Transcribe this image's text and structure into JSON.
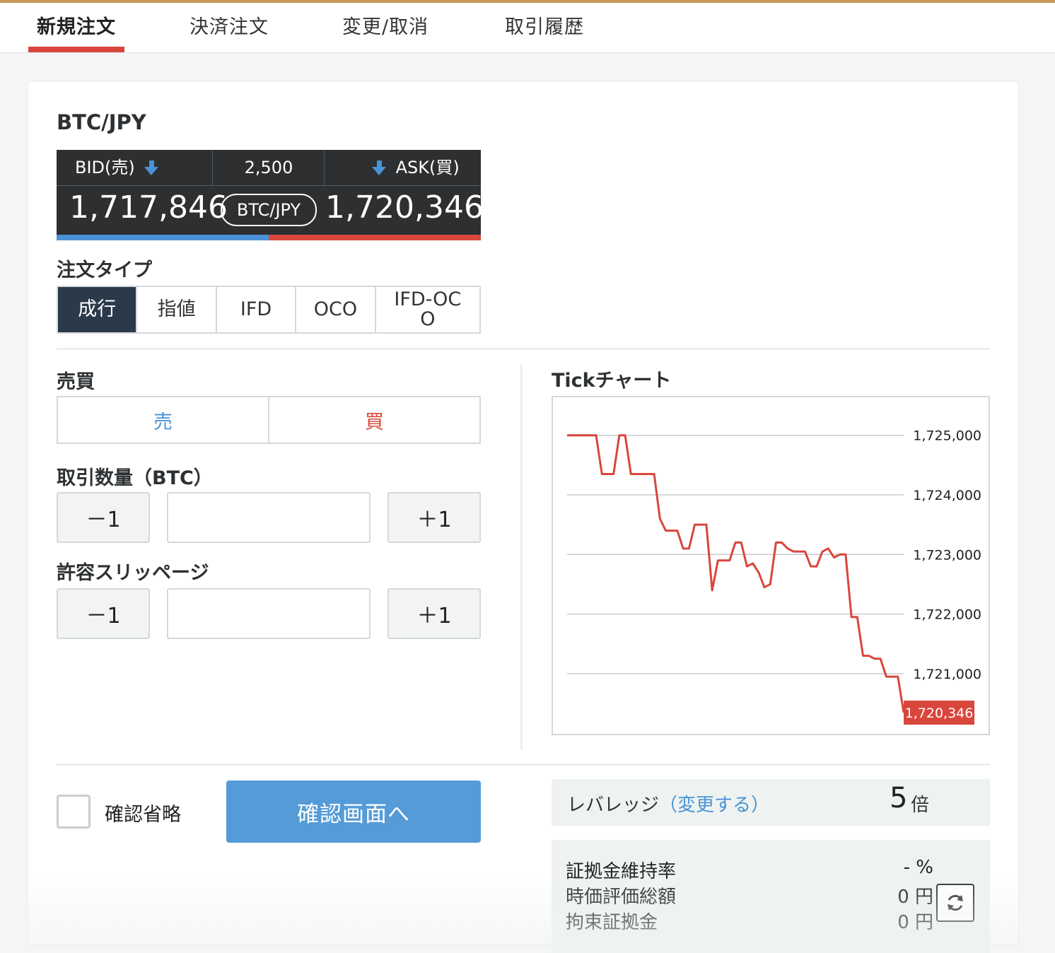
{
  "tabs": [
    "新規注文",
    "決済注文",
    "変更/取消",
    "取引履歴"
  ],
  "pair": "BTC/JPY",
  "ticker": {
    "bid_label": "BID(売)",
    "spread": "2,500",
    "ask_label": "ASK(買)",
    "bid_price": "1,717,846",
    "ask_price": "1,720,346",
    "pair_pill": "BTC/JPY",
    "bid_direction": "down-arrow-icon",
    "ask_direction": "down-arrow-icon"
  },
  "order_type": {
    "label": "注文タイプ",
    "options": [
      "成行",
      "指値",
      "IFD",
      "OCO",
      "IFD-OCO"
    ],
    "selected": "成行"
  },
  "buy_sell": {
    "label": "売買",
    "sell": "売",
    "buy": "買"
  },
  "quantity": {
    "label": "取引数量（BTC）",
    "minus": "－1",
    "plus": "＋1",
    "value": ""
  },
  "slippage": {
    "label": "許容スリッページ",
    "minus": "－1",
    "plus": "＋1",
    "value": ""
  },
  "tick_chart": {
    "title": "Tickチャート",
    "current_label": "1,720,346"
  },
  "chart_data": {
    "type": "line",
    "ylim": [
      1720346,
      1725400
    ],
    "yticks": [
      1725000,
      1724000,
      1723000,
      1722000,
      1721000
    ],
    "ytick_labels": [
      "1,725,000",
      "1,724,000",
      "1,723,000",
      "1,722,000",
      "1,721,000"
    ],
    "grid": true,
    "series": [
      {
        "color": "#d9463c",
        "values": [
          1725000,
          1725000,
          1725000,
          1725000,
          1725000,
          1725000,
          1724350,
          1724350,
          1724350,
          1725000,
          1725000,
          1724350,
          1724350,
          1724350,
          1724350,
          1724350,
          1723600,
          1723400,
          1723400,
          1723400,
          1723100,
          1723100,
          1723500,
          1723500,
          1723500,
          1722400,
          1722900,
          1722900,
          1722900,
          1723200,
          1723200,
          1722800,
          1722850,
          1722700,
          1722450,
          1722500,
          1723200,
          1723200,
          1723100,
          1723050,
          1723050,
          1723050,
          1722800,
          1722800,
          1723050,
          1723100,
          1722950,
          1723000,
          1723000,
          1721950,
          1721950,
          1721300,
          1721300,
          1721250,
          1721250,
          1720950,
          1720950,
          1720950,
          1720346
        ]
      }
    ]
  },
  "confirm": {
    "skip_label": "確認省略",
    "button": "確認画面へ"
  },
  "leverage": {
    "label": "レバレッジ",
    "link": "（変更する）",
    "value": "5",
    "unit": "倍"
  },
  "margin": {
    "rows": [
      {
        "label": "証拠金維持率",
        "value": "- %"
      },
      {
        "label": "時価評価総額",
        "value": "0 円"
      },
      {
        "label": "拘束証拠金",
        "value": "0 円"
      }
    ],
    "refresh_icon": "refresh-icon"
  },
  "colors": {
    "accent_red": "#d9463c",
    "accent_blue": "#4a93d6",
    "dark": "#2a3a4b",
    "button_blue": "#559bd8"
  }
}
